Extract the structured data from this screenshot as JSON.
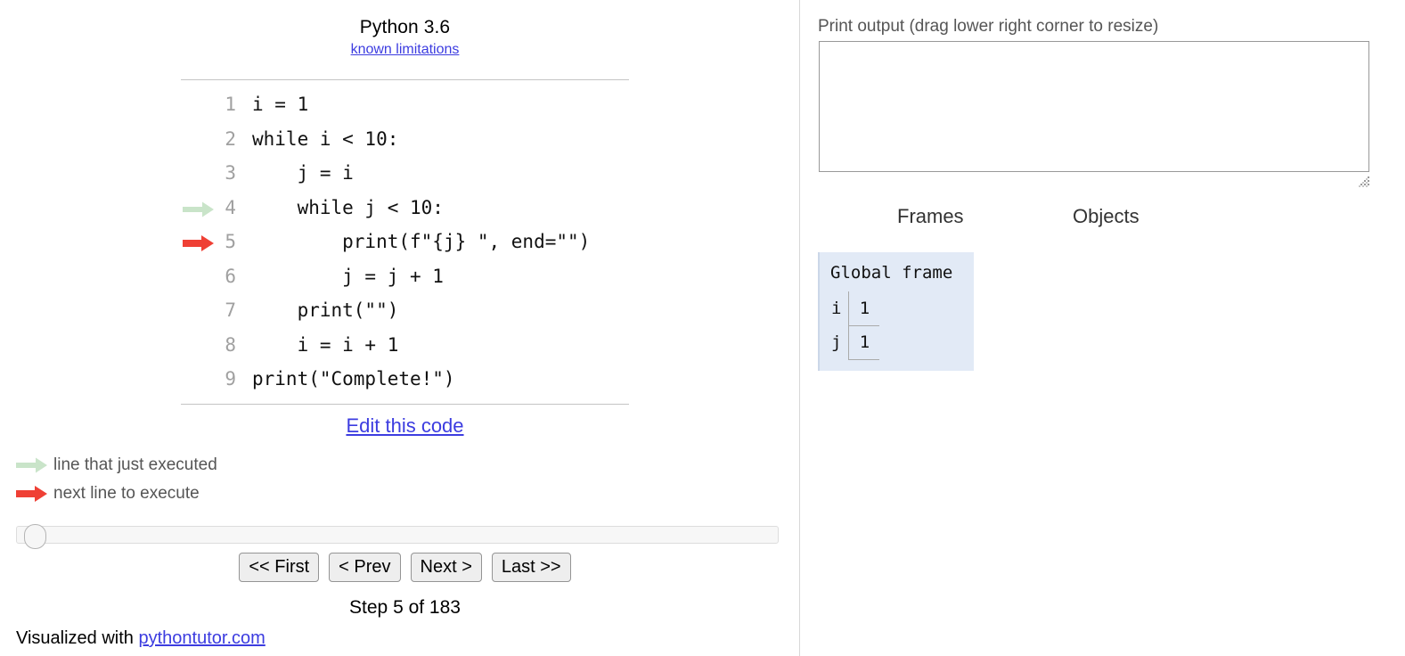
{
  "left": {
    "python_version": "Python 3.6",
    "known_limitations_link": "known limitations",
    "code": [
      {
        "num": "1",
        "text": "i = 1",
        "arrow": "none"
      },
      {
        "num": "2",
        "text": "while i < 10:",
        "arrow": "none"
      },
      {
        "num": "3",
        "text": "    j = i",
        "arrow": "none"
      },
      {
        "num": "4",
        "text": "    while j < 10:",
        "arrow": "green"
      },
      {
        "num": "5",
        "text": "        print(f\"{j} \", end=\"\")",
        "arrow": "red"
      },
      {
        "num": "6",
        "text": "        j = j + 1",
        "arrow": "none"
      },
      {
        "num": "7",
        "text": "    print(\"\")",
        "arrow": "none"
      },
      {
        "num": "8",
        "text": "    i = i + 1",
        "arrow": "none"
      },
      {
        "num": "9",
        "text": "print(\"Complete!\")",
        "arrow": "none"
      }
    ],
    "edit_code_label": "Edit this code",
    "legend": {
      "just_executed": "line that just executed",
      "next_line": "next line to execute"
    },
    "nav": {
      "first": "<< First",
      "prev": "< Prev",
      "next": "Next >",
      "last": "Last >>"
    },
    "step_counter": "Step 5 of 183",
    "slider_position_percent": 0,
    "footer_prefix": "Visualized with ",
    "footer_link": "pythontutor.com"
  },
  "right": {
    "print_output_label": "Print output (drag lower right corner to resize)",
    "print_output_value": "",
    "frames_header": "Frames",
    "objects_header": "Objects",
    "frames": [
      {
        "title": "Global frame",
        "vars": [
          {
            "name": "i",
            "value": "1"
          },
          {
            "name": "j",
            "value": "1"
          }
        ]
      }
    ]
  },
  "colors": {
    "green_arrow": "#c9e4c9",
    "red_arrow": "#ef4035",
    "link": "#3c3ce0",
    "frame_bg": "#e2eaf6",
    "muted_text": "#555555",
    "line_number": "#a0a0a0"
  }
}
